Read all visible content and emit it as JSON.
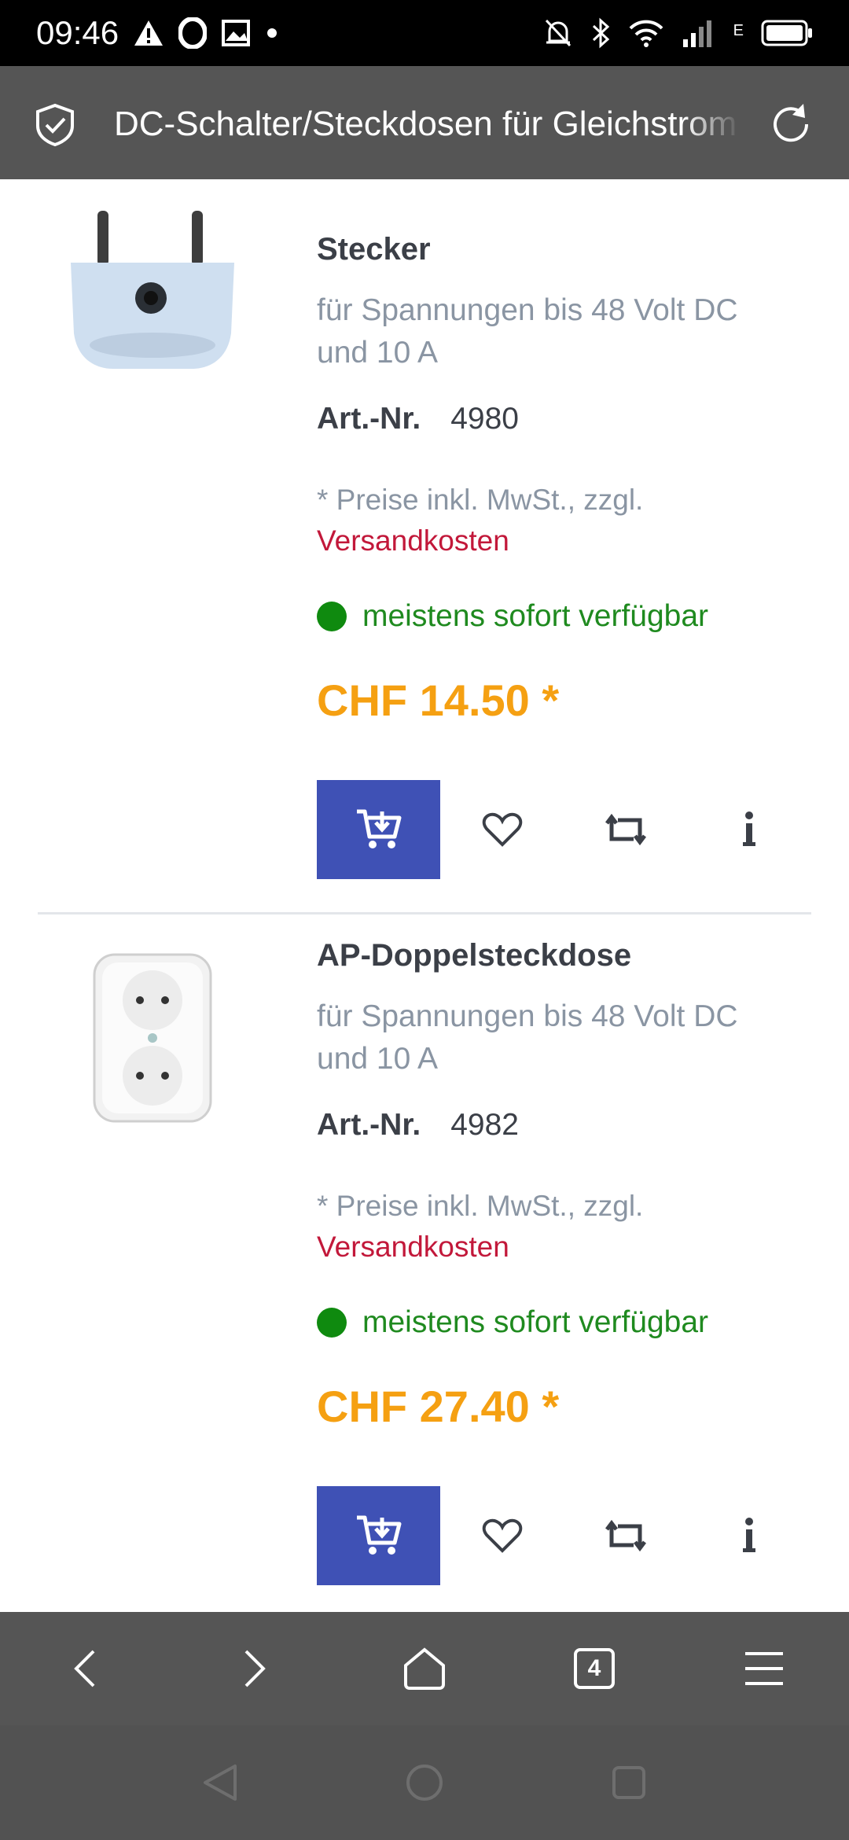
{
  "status_bar": {
    "time": "09:46",
    "network_type": "E",
    "icons": [
      "warning-icon",
      "opera-icon",
      "photo-icon",
      "notification-dot",
      "bell-muted-icon",
      "bluetooth-icon",
      "wifi-icon",
      "signal-icon",
      "battery-icon"
    ]
  },
  "browser": {
    "url_title": "DC-Schalter/Steckdosen für Gleichstrom",
    "tab_count": "4"
  },
  "products": [
    {
      "title": "Stecker",
      "description": "für Spannungen bis 48 Volt DC und 10 A",
      "art_label": "Art.-Nr.",
      "art_number": "4980",
      "price_note": "* Preise inkl. MwSt., zzgl.",
      "shipping_link": "Versandkosten",
      "availability": "meistens sofort verfügbar",
      "price": "CHF 14.50 *"
    },
    {
      "title": "AP-Doppelsteckdose",
      "description": "für Spannungen bis 48 Volt DC und 10 A",
      "art_label": "Art.-Nr.",
      "art_number": "4982",
      "price_note": "* Preise inkl. MwSt., zzgl.",
      "shipping_link": "Versandkosten",
      "availability": "meistens sofort verfügbar",
      "price": "CHF 27.40 *"
    }
  ],
  "colors": {
    "cart_button": "#3f51b5",
    "price": "#f5a012",
    "availability": "#1f8a1f",
    "shipping_link": "#c2183a",
    "browser_bar": "#555555"
  }
}
